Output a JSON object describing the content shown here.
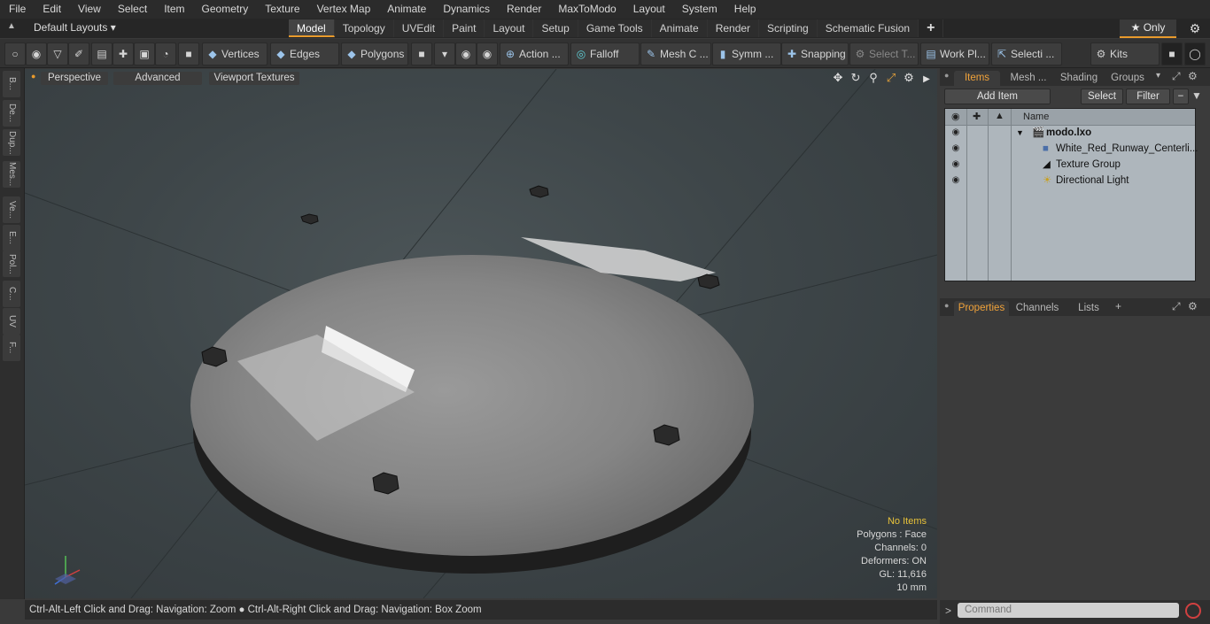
{
  "menu": [
    "File",
    "Edit",
    "View",
    "Select",
    "Item",
    "Geometry",
    "Texture",
    "Vertex Map",
    "Animate",
    "Dynamics",
    "Render",
    "MaxToModo",
    "Layout",
    "System",
    "Help"
  ],
  "layouts": {
    "label": "Default Layouts ▾"
  },
  "tabs": [
    "Model",
    "Topology",
    "UVEdit",
    "Paint",
    "Layout",
    "Setup",
    "Game Tools",
    "Animate",
    "Render",
    "Scripting",
    "Schematic Fusion"
  ],
  "only_label": "★ Only",
  "toolbar": {
    "vertices": "Vertices",
    "edges": "Edges",
    "polygons": "Polygons",
    "action": "Action",
    "falloff": "Falloff",
    "mesh": "Mesh C ...",
    "symm": "Symm ...",
    "snapping": "Snapping",
    "select_t": "Select T...",
    "workpl": "Work Pl...",
    "selecti": "Selecti ...",
    "kits": "Kits"
  },
  "left_tabs": [
    "B...",
    "De...",
    "Dup...",
    "Mes...",
    "Ve...",
    "E...",
    "Pol...",
    "C...",
    "UV",
    "F..."
  ],
  "viewport": {
    "perspective": "Perspective",
    "advanced": "Advanced",
    "textures": "Viewport Textures"
  },
  "stats": {
    "no_items": "No Items",
    "polygons": "Polygons : Face",
    "channels": "Channels: 0",
    "deformers": "Deformers: ON",
    "gl": "GL: 11,616",
    "size": "10 mm"
  },
  "status": "Ctrl-Alt-Left Click and Drag: Navigation: Zoom ● Ctrl-Alt-Right Click and Drag: Navigation: Box Zoom",
  "items_panel": {
    "tabs": [
      "Items",
      "Mesh ...",
      "Shading",
      "Groups"
    ],
    "add_item": "Add Item",
    "select": "Select",
    "filter": "Filter",
    "col_name": "Name",
    "rows": [
      "modo.lxo",
      "White_Red_Runway_Centerli...",
      "Texture Group",
      "Directional Light"
    ]
  },
  "props_panel": {
    "tabs": [
      "Properties",
      "Channels",
      "Lists"
    ]
  },
  "command_placeholder": "Command"
}
